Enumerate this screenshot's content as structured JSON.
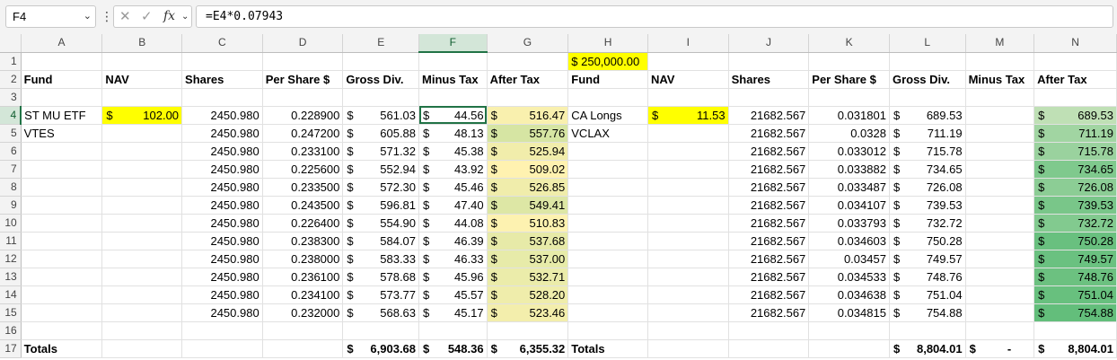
{
  "formula_bar": {
    "name_box": "F4",
    "formula": "=E4*0.07943"
  },
  "columns": [
    "A",
    "B",
    "C",
    "D",
    "E",
    "F",
    "G",
    "H",
    "I",
    "J",
    "K",
    "L",
    "M",
    "N"
  ],
  "selected_col": "F",
  "selected_row": 4,
  "cells": {
    "H1": "$ 250,000.00",
    "A2": "Fund",
    "B2": "NAV",
    "C2": "Shares",
    "D2": "Per Share $",
    "E2": "Gross Div.",
    "F2": "Minus Tax",
    "G2": "After Tax",
    "H2": "Fund",
    "I2": "NAV",
    "J2": "Shares",
    "K2": "Per Share $",
    "L2": "Gross Div.",
    "M2": "Minus Tax",
    "N2": "After Tax",
    "A4": "ST MU ETF",
    "B4": "102.00",
    "H4": "CA Longs",
    "I4": "11.53",
    "A5": "VTES",
    "H5": "VCLAX",
    "A17": "Totals",
    "E17": "6,903.68",
    "F17": "548.36",
    "G17": "6,355.32",
    "H17": "Totals",
    "L17": "8,804.01",
    "M17": "-",
    "N17": "8,804.01"
  },
  "rows": [
    {
      "r": 4,
      "C": "2450.980",
      "D": "0.228900",
      "E": "561.03",
      "F": "44.56",
      "G": "516.47",
      "J": "21682.567",
      "K": "0.031801",
      "L": "689.53",
      "N": "689.53"
    },
    {
      "r": 5,
      "C": "2450.980",
      "D": "0.247200",
      "E": "605.88",
      "F": "48.13",
      "G": "557.76",
      "J": "21682.567",
      "K": "0.0328",
      "L": "711.19",
      "N": "711.19"
    },
    {
      "r": 6,
      "C": "2450.980",
      "D": "0.233100",
      "E": "571.32",
      "F": "45.38",
      "G": "525.94",
      "J": "21682.567",
      "K": "0.033012",
      "L": "715.78",
      "N": "715.78"
    },
    {
      "r": 7,
      "C": "2450.980",
      "D": "0.225600",
      "E": "552.94",
      "F": "43.92",
      "G": "509.02",
      "J": "21682.567",
      "K": "0.033882",
      "L": "734.65",
      "N": "734.65"
    },
    {
      "r": 8,
      "C": "2450.980",
      "D": "0.233500",
      "E": "572.30",
      "F": "45.46",
      "G": "526.85",
      "J": "21682.567",
      "K": "0.033487",
      "L": "726.08",
      "N": "726.08"
    },
    {
      "r": 9,
      "C": "2450.980",
      "D": "0.243500",
      "E": "596.81",
      "F": "47.40",
      "G": "549.41",
      "J": "21682.567",
      "K": "0.034107",
      "L": "739.53",
      "N": "739.53"
    },
    {
      "r": 10,
      "C": "2450.980",
      "D": "0.226400",
      "E": "554.90",
      "F": "44.08",
      "G": "510.83",
      "J": "21682.567",
      "K": "0.033793",
      "L": "732.72",
      "N": "732.72"
    },
    {
      "r": 11,
      "C": "2450.980",
      "D": "0.238300",
      "E": "584.07",
      "F": "46.39",
      "G": "537.68",
      "J": "21682.567",
      "K": "0.034603",
      "L": "750.28",
      "N": "750.28"
    },
    {
      "r": 12,
      "C": "2450.980",
      "D": "0.238000",
      "E": "583.33",
      "F": "46.33",
      "G": "537.00",
      "J": "21682.567",
      "K": "0.03457",
      "L": "749.57",
      "N": "749.57"
    },
    {
      "r": 13,
      "C": "2450.980",
      "D": "0.236100",
      "E": "578.68",
      "F": "45.96",
      "G": "532.71",
      "J": "21682.567",
      "K": "0.034533",
      "L": "748.76",
      "N": "748.76"
    },
    {
      "r": 14,
      "C": "2450.980",
      "D": "0.234100",
      "E": "573.77",
      "F": "45.57",
      "G": "528.20",
      "J": "21682.567",
      "K": "0.034638",
      "L": "751.04",
      "N": "751.04"
    },
    {
      "r": 15,
      "C": "2450.980",
      "D": "0.232000",
      "E": "568.63",
      "F": "45.17",
      "G": "523.46",
      "J": "21682.567",
      "K": "0.034815",
      "L": "754.88",
      "N": "754.88"
    }
  ],
  "currency_symbol": "$",
  "colors": {
    "highlight_yellow": "#ffff00",
    "selection_green": "#217346",
    "scale_G_low": "#fff2b0",
    "scale_G_high": "#d6e5a3",
    "scale_N_low": "#bfe0b5",
    "scale_N_high": "#63be7b"
  }
}
